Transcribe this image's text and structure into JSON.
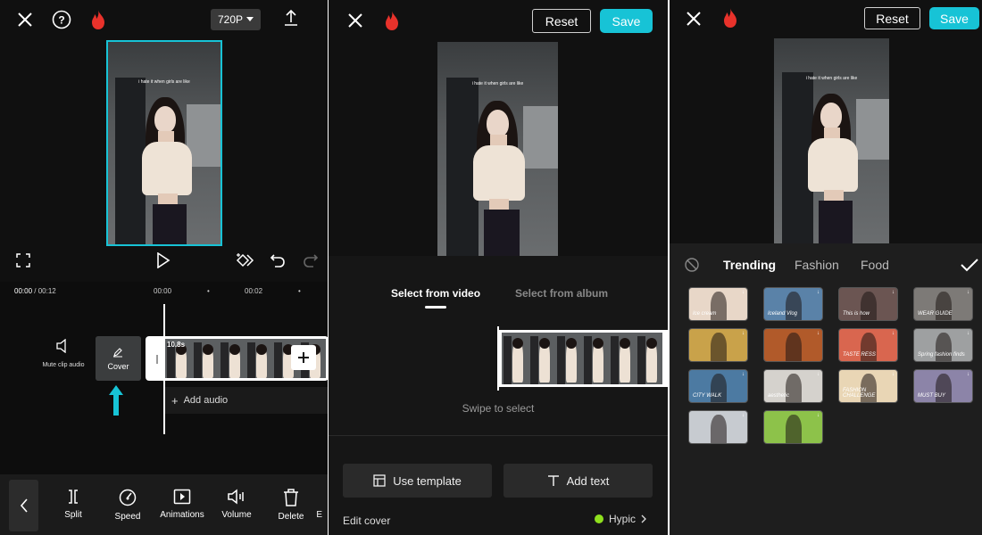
{
  "panel1": {
    "resolution": "720P",
    "time_current": "00:00",
    "time_total": "/ 00:12",
    "tick_0": "00:00",
    "tick_2": "00:02",
    "clip_duration": "10.8s",
    "mute_label": "Mute clip audio",
    "cover_label": "Cover",
    "add_audio": "Add audio",
    "caption": "i hate it when girls are like",
    "tools": [
      {
        "label": "Split",
        "icon": "split-icon"
      },
      {
        "label": "Speed",
        "icon": "speed-icon"
      },
      {
        "label": "Animations",
        "icon": "animations-icon"
      },
      {
        "label": "Volume",
        "icon": "volume-icon"
      },
      {
        "label": "Delete",
        "icon": "delete-icon"
      },
      {
        "label": "E",
        "icon": "edit-icon"
      }
    ],
    "accent": "#17c3d6",
    "flame_color": "#e8322b"
  },
  "panel2": {
    "reset": "Reset",
    "save": "Save",
    "caption": "i hate it when girls are like",
    "tab_video": "Select from video",
    "tab_album": "Select from album",
    "swipe_hint": "Swipe to select",
    "use_template": "Use template",
    "add_text": "Add text",
    "edit_cover": "Edit cover",
    "hypic": "Hypic",
    "hypic_dot": "#8fe01e"
  },
  "panel3": {
    "reset": "Reset",
    "save": "Save",
    "caption": "i hate it when girls are like",
    "tabs": [
      "Trending",
      "Fashion",
      "Food"
    ],
    "templates": [
      {
        "text": "Ice cream",
        "bg": "#e8d7c8"
      },
      {
        "text": "Iceland Vlog",
        "bg": "#5a82a8"
      },
      {
        "text": "This is how",
        "bg": "#6b5552"
      },
      {
        "text": "WEAR GUIDE",
        "bg": "#7d7a77"
      },
      {
        "text": "",
        "bg": "#c9a24a"
      },
      {
        "text": "",
        "bg": "#b15a2a"
      },
      {
        "text": "TASTE RESS",
        "bg": "#d9664f"
      },
      {
        "text": "Spring fashion finds",
        "bg": "#9ea0a1"
      },
      {
        "text": "CITY WALK",
        "bg": "#4c7aa2"
      },
      {
        "text": "aesthetic",
        "bg": "#d5d2cd"
      },
      {
        "text": "FASHION CHALLENGE",
        "bg": "#e9d6b5"
      },
      {
        "text": "MUST BUY",
        "bg": "#8c84a8"
      },
      {
        "text": "",
        "bg": "#c7cbd0"
      },
      {
        "text": "",
        "bg": "#8dc24a"
      }
    ]
  }
}
